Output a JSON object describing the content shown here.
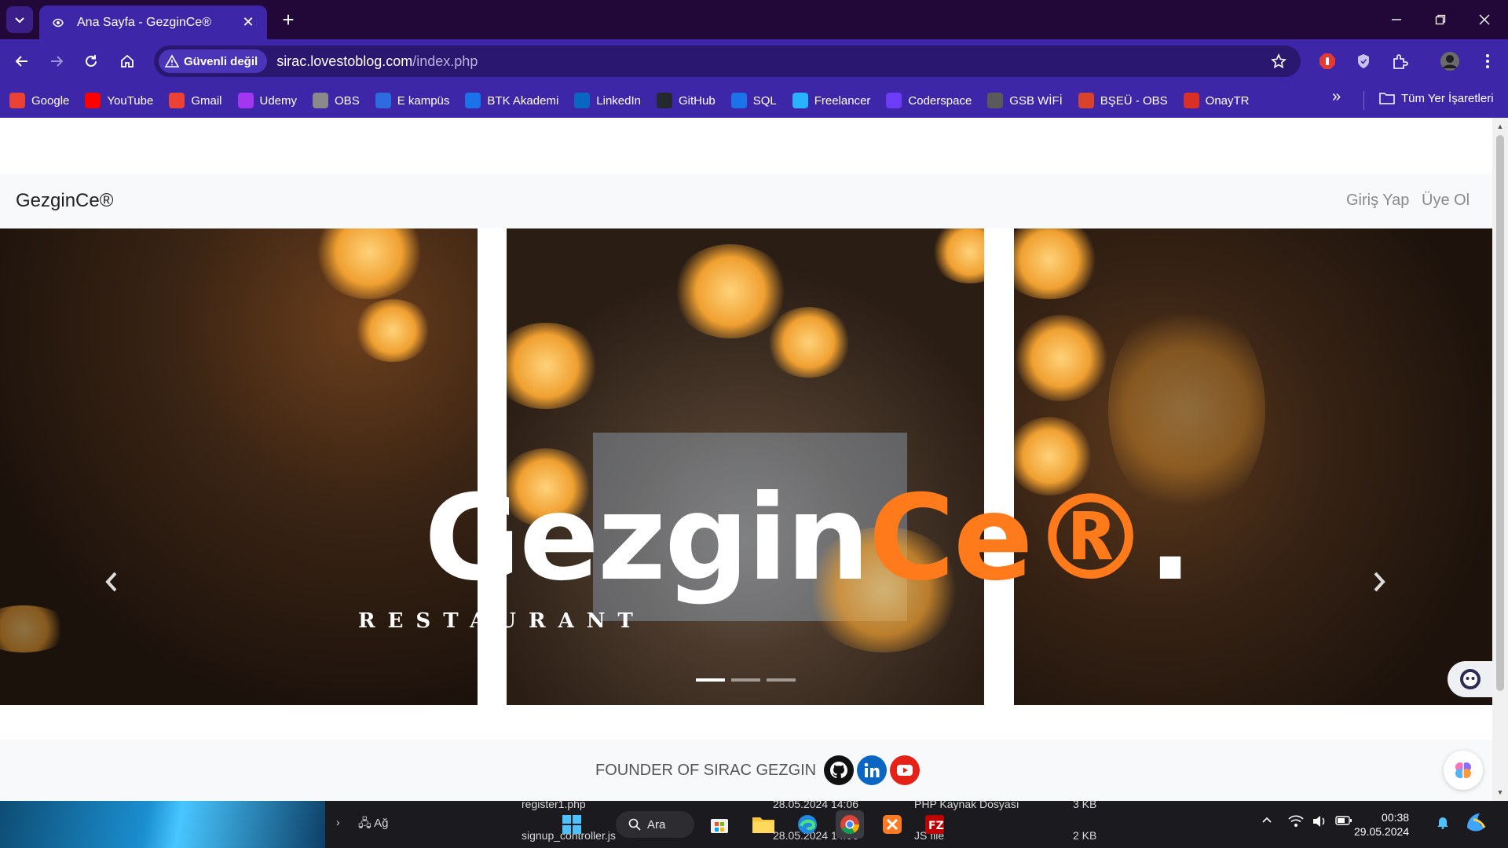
{
  "browser": {
    "tab_title": "Ana Sayfa - GezginCe®",
    "security_label": "Güvenli değil",
    "url_host": "sirac.lovestoblog.com",
    "url_path": "/index.php",
    "bookmarks": [
      {
        "label": "Google",
        "icon": "google-icon",
        "color": "#ea4335"
      },
      {
        "label": "YouTube",
        "icon": "youtube-icon",
        "color": "#ff0000"
      },
      {
        "label": "Gmail",
        "icon": "gmail-icon",
        "color": "#ea4335"
      },
      {
        "label": "Udemy",
        "icon": "udemy-icon",
        "color": "#a435f0"
      },
      {
        "label": "OBS",
        "icon": "globe-icon",
        "color": "#8a8a8a"
      },
      {
        "label": "E kampüs",
        "icon": "ekampus-icon",
        "color": "#2d6cdf"
      },
      {
        "label": "BTK Akademi",
        "icon": "btk-icon",
        "color": "#1a73e8"
      },
      {
        "label": "LinkedIn",
        "icon": "linkedin-icon",
        "color": "#0a66c2"
      },
      {
        "label": "GitHub",
        "icon": "github-icon",
        "color": "#24292f"
      },
      {
        "label": "SQL",
        "icon": "sql-icon",
        "color": "#1a73e8"
      },
      {
        "label": "Freelancer",
        "icon": "freelancer-icon",
        "color": "#29b2fe"
      },
      {
        "label": "Coderspace",
        "icon": "coderspace-icon",
        "color": "#6c3df5"
      },
      {
        "label": "GSB WİFİ",
        "icon": "gsb-icon",
        "color": "#5a5a5a"
      },
      {
        "label": "BŞEÜ - OBS",
        "icon": "bseu-icon",
        "color": "#d9432c"
      },
      {
        "label": "OnayTR",
        "icon": "onaytr-icon",
        "color": "#d93025"
      }
    ],
    "all_bookmarks_label": "Tüm Yer İşaretleri"
  },
  "page": {
    "brand": "GezginCe®",
    "nav_links": [
      "Giriş Yap",
      "Üye Ol"
    ],
    "hero_title_white": "Gezgin",
    "hero_title_orange": "Ce®",
    "hero_title_dot": ".",
    "hero_subtitle": "RESTAURANT",
    "founder_text": "FOUNDER OF SIRAC GEZGIN",
    "slide_count": 3,
    "active_slide": 1,
    "colors": {
      "accent": "#ff7a1a",
      "chrome": "#3d27a8",
      "titlebar": "#210838"
    }
  },
  "taskbar": {
    "search_label": "Ara",
    "network_label": "Ağ",
    "files": [
      {
        "name": "register1.php",
        "date": "28.05.2024 14:06",
        "type": "PHP Kaynak Dosyası",
        "size": "3 KB"
      },
      {
        "name": "signup_controller.js",
        "date": "28.05.2024 14:06",
        "type": "JS file",
        "size": "2 KB"
      }
    ],
    "time": "00:38",
    "date": "29.05.2024"
  }
}
